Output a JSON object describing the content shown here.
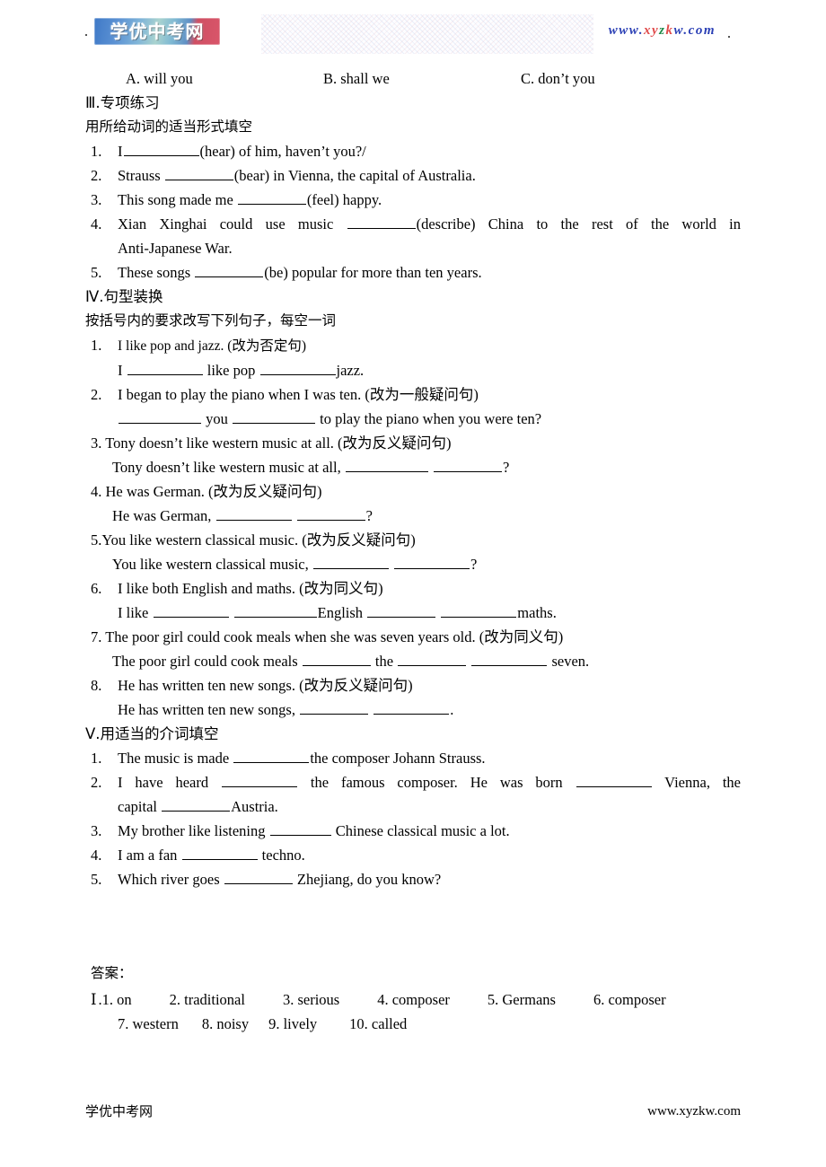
{
  "header": {
    "logo_text": "学优中考网",
    "url_parts": {
      "p1": "www.",
      "p2": "xy",
      "p3": "z",
      "p4": "k",
      "p5": "w.com"
    },
    "url_full": "www.xyzkw.com"
  },
  "options_row": {
    "a": "A. will you",
    "b": "B. shall we",
    "c": "C. don’t you"
  },
  "section3": {
    "heading": "Ⅲ.专项练习",
    "instruction": "用所给动词的适当形式填空",
    "items": [
      {
        "num": "1.",
        "pre": "I",
        "post": "(hear) of him, haven’t you?/"
      },
      {
        "num": "2.",
        "pre": "Strauss",
        "post": "(bear) in Vienna, the capital of Australia."
      },
      {
        "num": "3.",
        "pre": "This song made me",
        "post": "(feel) happy."
      },
      {
        "num": "4.",
        "pre": "Xian Xinghai could use music",
        "post": "(describe) China to the rest of the world in",
        "cont": "Anti-Japanese War."
      },
      {
        "num": "5.",
        "pre": "These songs",
        "post": "(be) popular for more than ten years."
      }
    ]
  },
  "section4": {
    "heading": "Ⅳ.句型装换",
    "instruction": "按括号内的要求改写下列句子，每空一词",
    "items": [
      {
        "num": "1.",
        "prompt": "I like pop and jazz. (改为否定句)",
        "ans_a": "I",
        "ans_b": "like pop",
        "ans_c": "jazz."
      },
      {
        "num": "2.",
        "prompt": "I began to play the piano when I was ten. (改为一般疑问句)",
        "ans_a": "",
        "ans_b": "you",
        "ans_c": "to play the piano when you were ten?"
      },
      {
        "num": "3.",
        "prompt": "Tony doesn’t like western music at all. (改为反义疑问句)",
        "ans_a": "Tony doesn’t like western music at all,",
        "ans_b": "?"
      },
      {
        "num": "4.",
        "prompt": "He was German. (改为反义疑问句)",
        "ans_a": "He was German,",
        "ans_b": "?"
      },
      {
        "num": "5.",
        "prompt": "You like western classical music. (改为反义疑问句)",
        "ans_a": "You like western classical music,",
        "ans_b": "?"
      },
      {
        "num": "6.",
        "prompt": "I like both English and maths. (改为同义句)",
        "ans_a": "I like",
        "ans_b": "English",
        "ans_c": "maths."
      },
      {
        "num": "7.",
        "prompt": "The poor girl could cook meals when she was seven years old. (改为同义句)",
        "ans_a": "The poor girl could cook meals",
        "ans_b": "the",
        "ans_c": "seven."
      },
      {
        "num": "8.",
        "prompt": "He has written ten new songs. (改为反义疑问句)",
        "ans_a": "He has written ten new songs,",
        "ans_b": "."
      }
    ]
  },
  "section5": {
    "heading": "Ⅴ.用适当的介词填空",
    "items": [
      {
        "num": "1.",
        "pre": "The music is made",
        "post": "the composer Johann Strauss."
      },
      {
        "num": "2.",
        "pre": "I have heard",
        "mid": "the famous composer. He was born",
        "post": "Vienna, the",
        "cont_pre": "capital",
        "cont_post": "Austria."
      },
      {
        "num": "3.",
        "pre": "My brother like listening",
        "post": "Chinese classical music a lot."
      },
      {
        "num": "4.",
        "pre": "I am a fan",
        "post": "techno."
      },
      {
        "num": "5.",
        "pre": "Which river goes",
        "post": "Zhejiang, do you know?"
      }
    ]
  },
  "answers": {
    "heading": "答案：",
    "label": "Ⅰ",
    "row1": [
      ".1. on",
      "2. traditional",
      "3. serious",
      "4. composer",
      "5. Germans",
      "6. composer"
    ],
    "row2": [
      "7. western",
      "8. noisy",
      "9. lively",
      "10. called"
    ]
  },
  "footer": {
    "left": "学优中考网",
    "right": "www.xyzkw.com"
  }
}
